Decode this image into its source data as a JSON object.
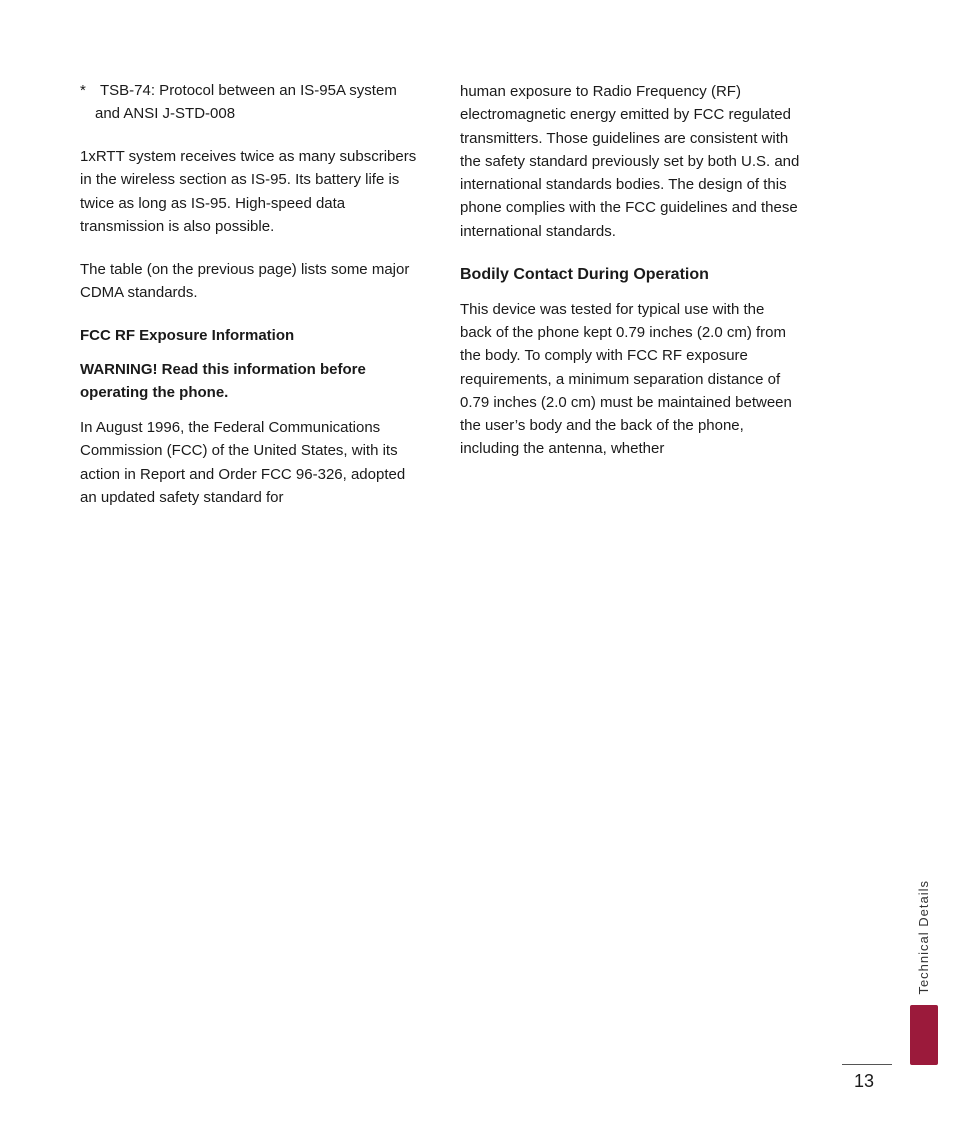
{
  "left_column": {
    "bullet": {
      "star": "*",
      "text": "TSB-74: Protocol between an IS-95A system and ANSI J-STD-008"
    },
    "paragraphs": [
      "1xRTT system receives twice as many subscribers in the wireless section as IS-95. Its battery life is twice as long as IS-95. High-speed data transmission is also possible.",
      "The table (on the previous page) lists some major CDMA standards."
    ],
    "fcc_section_heading": "FCC RF Exposure Information",
    "warning_heading": "WARNING! Read this information before operating the phone.",
    "warning_paragraph": "In August 1996, the Federal Communications Commission (FCC) of the United States, with its action in Report and Order FCC 96-326, adopted an updated safety standard for"
  },
  "right_column": {
    "intro_paragraph": "human exposure to Radio Frequency (RF) electromagnetic energy emitted by FCC regulated transmitters. Those guidelines are consistent with the safety standard previously set by both U.S. and international standards bodies. The design of this phone complies with the FCC guidelines and these international standards.",
    "bodily_heading": "Bodily Contact During Operation",
    "bodily_paragraph": "This device was tested for typical use with the back of the phone kept 0.79 inches (2.0 cm) from the body. To comply with FCC RF exposure requirements, a minimum separation distance of 0.79 inches (2.0 cm) must be maintained between the user’s body and the back of the phone, including the antenna, whether"
  },
  "sidebar": {
    "label": "Technical Details",
    "bar_color": "#9b1a3b"
  },
  "page_number": "13"
}
